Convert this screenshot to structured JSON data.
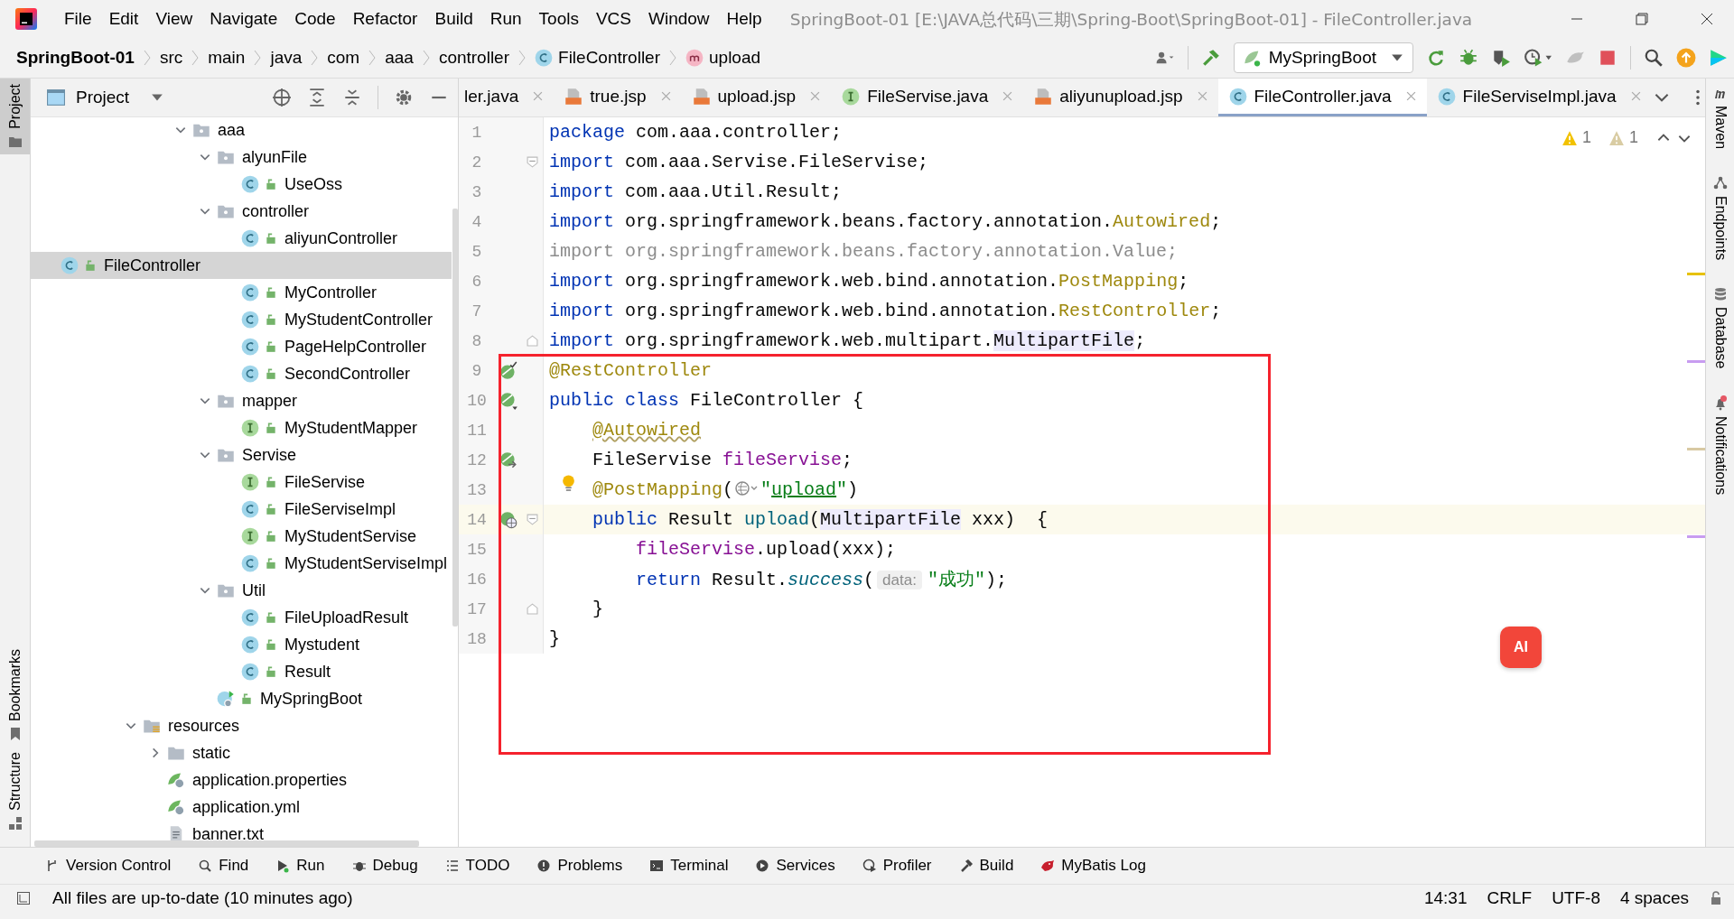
{
  "window": {
    "title": "SpringBoot-01 [E:\\JAVA总代码\\三期\\Spring-Boot\\SpringBoot-01] - FileController.java"
  },
  "menu": [
    "File",
    "Edit",
    "View",
    "Navigate",
    "Code",
    "Refactor",
    "Build",
    "Run",
    "Tools",
    "VCS",
    "Window",
    "Help"
  ],
  "breadcrumbs": [
    {
      "label": "SpringBoot-01",
      "kind": "project"
    },
    {
      "label": "src",
      "kind": "dir"
    },
    {
      "label": "main",
      "kind": "dir"
    },
    {
      "label": "java",
      "kind": "dir"
    },
    {
      "label": "com",
      "kind": "dir"
    },
    {
      "label": "aaa",
      "kind": "dir"
    },
    {
      "label": "controller",
      "kind": "dir"
    },
    {
      "label": "FileController",
      "kind": "class"
    },
    {
      "label": "upload",
      "kind": "method"
    }
  ],
  "run_config": {
    "label": "MySpringBoot"
  },
  "left_stripe": [
    {
      "label": "Project",
      "kind": "project",
      "selected": true
    },
    {
      "label": "Bookmarks",
      "kind": "bookmarks",
      "selected": false
    },
    {
      "label": "Structure",
      "kind": "structure",
      "selected": false
    }
  ],
  "project_panel": {
    "title": "Project",
    "package_tree": [
      {
        "label": "aaa",
        "kind": "package",
        "expanded": true,
        "selected": false,
        "children": [
          {
            "label": "alyunFile",
            "kind": "package",
            "expanded": true,
            "selected": false,
            "children": [
              {
                "label": "UseOss",
                "kind": "class",
                "selected": false
              }
            ]
          },
          {
            "label": "controller",
            "kind": "package",
            "expanded": true,
            "selected": false,
            "children": [
              {
                "label": "aliyunController",
                "kind": "class",
                "selected": false
              },
              {
                "label": "FileController",
                "kind": "class",
                "selected": true
              },
              {
                "label": "MyController",
                "kind": "class",
                "selected": false
              },
              {
                "label": "MyStudentController",
                "kind": "class",
                "selected": false
              },
              {
                "label": "PageHelpController",
                "kind": "class",
                "selected": false
              },
              {
                "label": "SecondController",
                "kind": "class",
                "selected": false
              }
            ]
          },
          {
            "label": "mapper",
            "kind": "package",
            "expanded": true,
            "selected": false,
            "children": [
              {
                "label": "MyStudentMapper",
                "kind": "interface",
                "selected": false
              }
            ]
          },
          {
            "label": "Servise",
            "kind": "package",
            "expanded": true,
            "selected": false,
            "children": [
              {
                "label": "FileServise",
                "kind": "interface",
                "selected": false
              },
              {
                "label": "FileServiseImpl",
                "kind": "class",
                "selected": false
              },
              {
                "label": "MyStudentServise",
                "kind": "interface",
                "selected": false
              },
              {
                "label": "MyStudentServiseImpl",
                "kind": "class",
                "selected": false
              }
            ]
          },
          {
            "label": "Util",
            "kind": "package",
            "expanded": true,
            "selected": false,
            "children": [
              {
                "label": "FileUploadResult",
                "kind": "class",
                "selected": false
              },
              {
                "label": "Mystudent",
                "kind": "class",
                "selected": false
              },
              {
                "label": "Result",
                "kind": "class",
                "selected": false
              }
            ]
          },
          {
            "label": "MySpringBoot",
            "kind": "boot",
            "selected": false
          }
        ]
      }
    ],
    "resource_tree": [
      {
        "label": "resources",
        "kind": "resources",
        "expanded": true,
        "selected": false,
        "children": [
          {
            "label": "static",
            "kind": "folder",
            "expanded": false,
            "selected": false
          },
          {
            "label": "application.properties",
            "kind": "config",
            "selected": false
          },
          {
            "label": "application.yml",
            "kind": "config",
            "selected": false
          },
          {
            "label": "banner.txt",
            "kind": "text",
            "selected": false
          }
        ]
      }
    ]
  },
  "editor_tabs": [
    {
      "label": "ler.java",
      "kind": "none",
      "selected": false
    },
    {
      "label": "true.jsp",
      "kind": "jsp",
      "selected": false
    },
    {
      "label": "upload.jsp",
      "kind": "jsp",
      "selected": false
    },
    {
      "label": "FileServise.java",
      "kind": "interface",
      "selected": false
    },
    {
      "label": "aliyunupload.jsp",
      "kind": "jsp",
      "selected": false
    },
    {
      "label": "FileController.java",
      "kind": "class",
      "selected": true
    },
    {
      "label": "FileServiseImpl.java",
      "kind": "class",
      "selected": false
    }
  ],
  "inspections": {
    "warnings": "1",
    "weak_warnings": "1"
  },
  "code_lines": [
    {
      "number": "1",
      "current": false,
      "segments": [
        {
          "kind": "kw",
          "text": "package"
        },
        {
          "kind": "plain",
          "text": " com.aaa.controller;"
        }
      ]
    },
    {
      "number": "2",
      "current": false,
      "fold": {
        "kind": "start"
      },
      "segments": [
        {
          "kind": "kw",
          "text": "import"
        },
        {
          "kind": "plain",
          "text": " com.aaa.Servise.FileServise;"
        }
      ]
    },
    {
      "number": "3",
      "current": false,
      "segments": [
        {
          "kind": "kw",
          "text": "import"
        },
        {
          "kind": "plain",
          "text": " com.aaa.Util.Result;"
        }
      ]
    },
    {
      "number": "4",
      "current": false,
      "segments": [
        {
          "kind": "kw",
          "text": "import"
        },
        {
          "kind": "plain",
          "text": " org.springframework.beans.factory.annotation."
        },
        {
          "kind": "ann",
          "text": "Autowired"
        },
        {
          "kind": "plain",
          "text": ";"
        }
      ]
    },
    {
      "number": "5",
      "current": false,
      "segments": [
        {
          "kind": "unused",
          "text": "import org.springframework.beans.factory.annotation.Value;"
        }
      ]
    },
    {
      "number": "6",
      "current": false,
      "segments": [
        {
          "kind": "kw",
          "text": "import"
        },
        {
          "kind": "plain",
          "text": " org.springframework.web.bind.annotation."
        },
        {
          "kind": "ann",
          "text": "PostMapping"
        },
        {
          "kind": "plain",
          "text": ";"
        }
      ]
    },
    {
      "number": "7",
      "current": false,
      "segments": [
        {
          "kind": "kw",
          "text": "import"
        },
        {
          "kind": "plain",
          "text": " org.springframework.web.bind.annotation."
        },
        {
          "kind": "ann",
          "text": "RestController"
        },
        {
          "kind": "plain",
          "text": ";"
        }
      ]
    },
    {
      "number": "8",
      "current": false,
      "fold": {
        "kind": "end"
      },
      "segments": [
        {
          "kind": "kw",
          "text": "import"
        },
        {
          "kind": "plain",
          "text": " org.springframework.web.multipart."
        },
        {
          "kind": "ref",
          "text": "MultipartFile"
        },
        {
          "kind": "plain",
          "text": ";"
        }
      ]
    },
    {
      "number": "9",
      "current": false,
      "gutter": {
        "kind": "bean-check"
      },
      "segments": [
        {
          "kind": "ann",
          "text": "@RestController"
        }
      ]
    },
    {
      "number": "10",
      "current": false,
      "gutter": {
        "kind": "bean"
      },
      "segments": [
        {
          "kind": "kw",
          "text": "public class"
        },
        {
          "kind": "plain",
          "text": " FileController {"
        }
      ]
    },
    {
      "number": "11",
      "current": false,
      "segments": [
        {
          "kind": "indent"
        },
        {
          "kind": "ann-warn",
          "text": "@Autowired"
        }
      ]
    },
    {
      "number": "12",
      "current": false,
      "gutter": {
        "kind": "bean-link"
      },
      "segments": [
        {
          "kind": "indent"
        },
        {
          "kind": "plain",
          "text": "FileServise "
        },
        {
          "kind": "field",
          "text": "fileServise"
        },
        {
          "kind": "plain",
          "text": ";"
        }
      ]
    },
    {
      "number": "13",
      "current": false,
      "bulb": true,
      "segments": [
        {
          "kind": "indent"
        },
        {
          "kind": "ann",
          "text": "@PostMapping"
        },
        {
          "kind": "plain",
          "text": "("
        },
        {
          "kind": "inlay"
        },
        {
          "kind": "str",
          "text": "\""
        },
        {
          "kind": "link",
          "text": "upload"
        },
        {
          "kind": "str",
          "text": "\""
        },
        {
          "kind": "plain",
          "text": ")"
        }
      ]
    },
    {
      "number": "14",
      "current": true,
      "gutter": {
        "kind": "web"
      },
      "fold": {
        "kind": "start"
      },
      "segments": [
        {
          "kind": "indent"
        },
        {
          "kind": "kw",
          "text": "public"
        },
        {
          "kind": "plain",
          "text": " Result "
        },
        {
          "kind": "call",
          "text": "upload"
        },
        {
          "kind": "plain",
          "text": "("
        },
        {
          "kind": "ref",
          "text": "MultipartFile"
        },
        {
          "kind": "plain",
          "text": " xxx)  {"
        }
      ]
    },
    {
      "number": "15",
      "current": false,
      "segments": [
        {
          "kind": "indent"
        },
        {
          "kind": "indent"
        },
        {
          "kind": "field",
          "text": "fileServise"
        },
        {
          "kind": "plain",
          "text": ".upload(xxx);"
        }
      ]
    },
    {
      "number": "16",
      "current": false,
      "segments": [
        {
          "kind": "indent"
        },
        {
          "kind": "indent"
        },
        {
          "kind": "kw",
          "text": "return"
        },
        {
          "kind": "plain",
          "text": " Result."
        },
        {
          "kind": "static",
          "text": "success"
        },
        {
          "kind": "plain",
          "text": "("
        },
        {
          "kind": "hint",
          "text": "data:"
        },
        {
          "kind": "str",
          "text": "\"成功\""
        },
        {
          "kind": "plain",
          "text": ");"
        }
      ]
    },
    {
      "number": "17",
      "current": false,
      "fold": {
        "kind": "end"
      },
      "segments": [
        {
          "kind": "indent"
        },
        {
          "kind": "plain",
          "text": "}"
        }
      ]
    },
    {
      "number": "18",
      "current": false,
      "segments": [
        {
          "kind": "plain",
          "text": "}"
        }
      ]
    }
  ],
  "right_stripe": [
    {
      "label": "Maven",
      "kind": "maven",
      "badge": false
    },
    {
      "label": "Endpoints",
      "kind": "endpoints",
      "badge": false
    },
    {
      "label": "Database",
      "kind": "database",
      "badge": false
    },
    {
      "label": "Notifications",
      "kind": "bell",
      "badge": true
    }
  ],
  "ai_button": {
    "label": "AI"
  },
  "bottom_tools": [
    {
      "label": "Version Control",
      "kind": "vcs"
    },
    {
      "label": "Find",
      "kind": "find"
    },
    {
      "label": "Run",
      "kind": "run"
    },
    {
      "label": "Debug",
      "kind": "debug"
    },
    {
      "label": "TODO",
      "kind": "todo"
    },
    {
      "label": "Problems",
      "kind": "problems"
    },
    {
      "label": "Terminal",
      "kind": "terminal"
    },
    {
      "label": "Services",
      "kind": "services"
    },
    {
      "label": "Profiler",
      "kind": "profiler"
    },
    {
      "label": "Build",
      "kind": "build"
    },
    {
      "label": "MyBatis Log",
      "kind": "bird"
    }
  ],
  "status_bar": {
    "message": "All files are up-to-date (10 minutes ago)",
    "items": [
      "14:31",
      "CRLF",
      "UTF-8",
      "4 spaces"
    ]
  }
}
